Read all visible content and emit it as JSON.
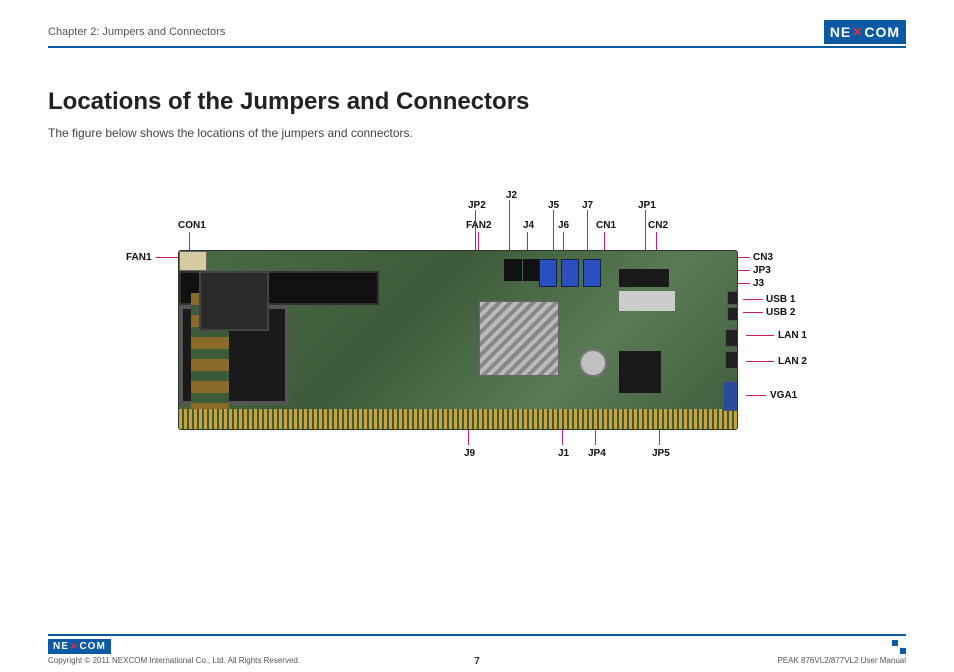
{
  "header": {
    "chapter": "Chapter 2: Jumpers and Connectors",
    "brand": "NEXCOM"
  },
  "title": "Locations of the Jumpers and Connectors",
  "subtitle": "The figure below shows the locations of the jumpers and connectors.",
  "labels": {
    "top": {
      "JP2": "JP2",
      "J2": "J2",
      "J5": "J5",
      "J7": "J7",
      "JP1": "JP1",
      "CON1": "CON1",
      "FAN2": "FAN2",
      "J4": "J4",
      "J6": "J6",
      "CN1": "CN1",
      "CN2": "CN2"
    },
    "left": {
      "FAN1": "FAN1"
    },
    "right": {
      "CN3": "CN3",
      "JP3": "JP3",
      "J3": "J3",
      "USB1": "USB 1",
      "USB2": "USB 2",
      "LAN1": "LAN 1",
      "LAN2": "LAN 2",
      "VGA1": "VGA1"
    },
    "bottom": {
      "J9": "J9",
      "J1": "J1",
      "JP4": "JP4",
      "JP5": "JP5"
    }
  },
  "footer": {
    "brand": "NEXCOM",
    "copyright": "Copyright © 2011 NEXCOM International Co., Ltd. All Rights Reserved.",
    "page": "7",
    "manual": "PEAK 876VL2/877VL2 User Manual"
  }
}
